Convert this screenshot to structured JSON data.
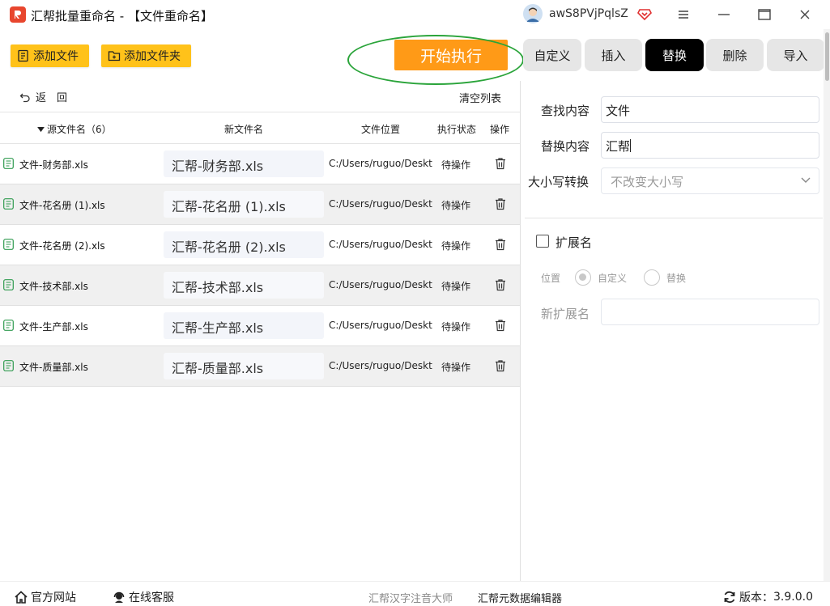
{
  "window": {
    "title": "汇帮批量重命名 - 【文件重命名】",
    "username": "awS8PVjPqlsZ"
  },
  "toolbar": {
    "add_file": "添加文件",
    "add_folder": "添加文件夹",
    "start": "开始执行"
  },
  "tabs": [
    {
      "label": "自定义",
      "active": false
    },
    {
      "label": "插入",
      "active": false
    },
    {
      "label": "替换",
      "active": true
    },
    {
      "label": "删除",
      "active": false
    },
    {
      "label": "导入",
      "active": false
    }
  ],
  "list": {
    "back": "返　回",
    "clear": "清空列表",
    "columns": {
      "source": "源文件名（6）",
      "new_name": "新文件名",
      "location": "文件位置",
      "status": "执行状态",
      "action": "操作"
    },
    "rows": [
      {
        "source": "文件-财务部.xls",
        "new_name": "汇帮-财务部.xls",
        "location": "C:/Users/ruguo/Desktop",
        "status": "待操作"
      },
      {
        "source": "文件-花名册 (1).xls",
        "new_name": "汇帮-花名册 (1).xls",
        "location": "C:/Users/ruguo/Desktop",
        "status": "待操作"
      },
      {
        "source": "文件-花名册 (2).xls",
        "new_name": "汇帮-花名册 (2).xls",
        "location": "C:/Users/ruguo/Desktop",
        "status": "待操作"
      },
      {
        "source": "文件-技术部.xls",
        "new_name": "汇帮-技术部.xls",
        "location": "C:/Users/ruguo/Desktop",
        "status": "待操作"
      },
      {
        "source": "文件-生产部.xls",
        "new_name": "汇帮-生产部.xls",
        "location": "C:/Users/ruguo/Desktop",
        "status": "待操作"
      },
      {
        "source": "文件-质量部.xls",
        "new_name": "汇帮-质量部.xls",
        "location": "C:/Users/ruguo/Desktop",
        "status": "待操作"
      }
    ]
  },
  "replace_panel": {
    "find_label": "查找内容",
    "find_value": "文件",
    "replace_label": "替换内容",
    "replace_value": "汇帮",
    "case_label": "大小写转换",
    "case_value": "不改变大小写",
    "ext_label": "扩展名",
    "position_label": "位置",
    "opt_custom": "自定义",
    "opt_replace": "替换",
    "new_ext_label": "新扩展名",
    "new_ext_value": ""
  },
  "footer": {
    "website": "官方网站",
    "support": "在线客服",
    "app1": "汇帮汉字注音大师",
    "app2": "汇帮元数据编辑器",
    "version_label": "版本：",
    "version": "3.9.0.0"
  },
  "colors": {
    "accent_yellow": "#ffc21a",
    "start_orange": "#ff9a17",
    "highlight_green": "#2aa43a"
  }
}
